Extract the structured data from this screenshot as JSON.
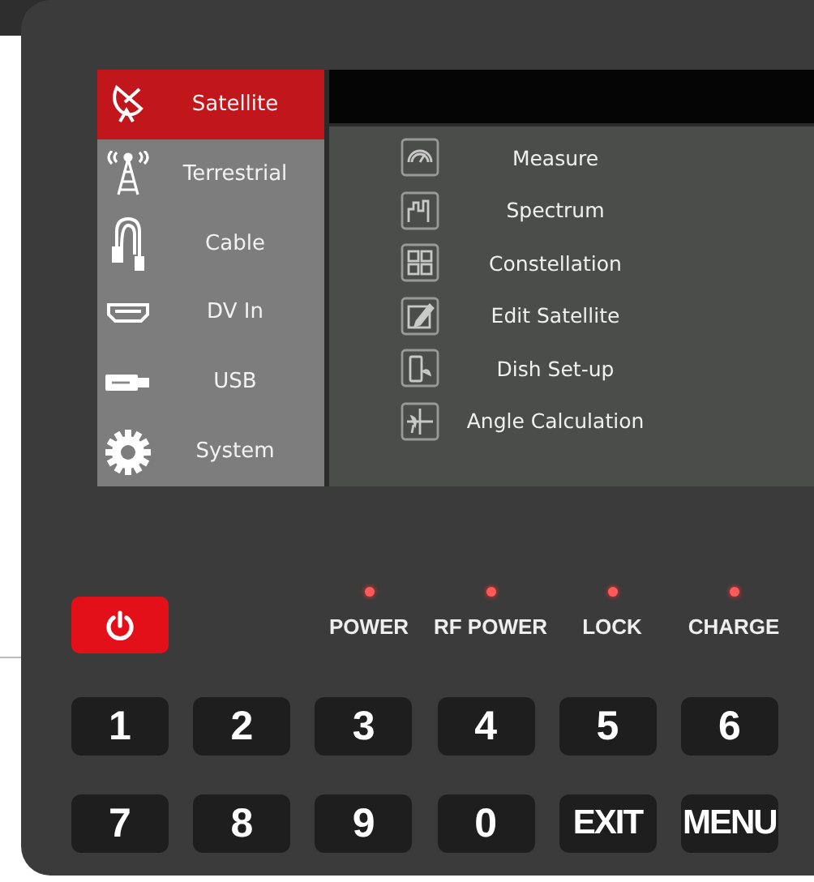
{
  "sidebar": {
    "items": [
      {
        "label": "Satellite",
        "selected": true
      },
      {
        "label": "Terrestrial",
        "selected": false
      },
      {
        "label": "Cable",
        "selected": false
      },
      {
        "label": "DV In",
        "selected": false
      },
      {
        "label": "USB",
        "selected": false
      },
      {
        "label": "System",
        "selected": false
      }
    ]
  },
  "menu": {
    "items": [
      {
        "label": "Measure"
      },
      {
        "label": "Spectrum"
      },
      {
        "label": "Constellation"
      },
      {
        "label": "Edit Satellite"
      },
      {
        "label": "Dish Set-up"
      },
      {
        "label": "Angle Calculation"
      }
    ]
  },
  "indicators": [
    {
      "label": "POWER"
    },
    {
      "label": "RF POWER"
    },
    {
      "label": "LOCK"
    },
    {
      "label": "CHARGE"
    }
  ],
  "keys": [
    [
      "1",
      "2",
      "3",
      "4",
      "5",
      "6"
    ],
    [
      "7",
      "8",
      "9",
      "0",
      "EXIT",
      "MENU"
    ]
  ]
}
